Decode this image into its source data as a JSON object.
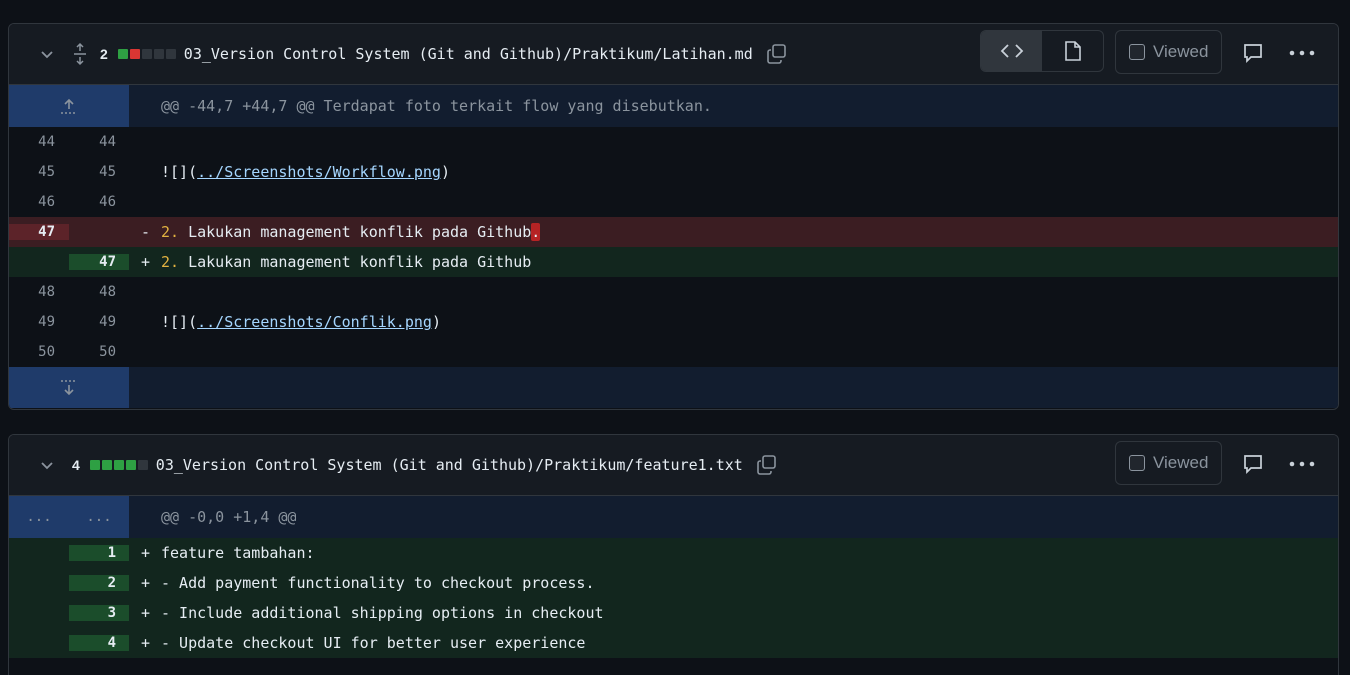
{
  "files": [
    {
      "change_count": "2",
      "blocks": [
        "g",
        "r",
        "n",
        "n",
        "n"
      ],
      "filename": "03_Version Control System (Git and Github)/Praktikum/Latihan.md",
      "viewed_label": "Viewed",
      "hunk": "@@ -44,7 +44,7 @@ Terdapat foto terkait flow yang disebutkan.",
      "lines": [
        {
          "type": "ctx",
          "old": "44",
          "new": "44",
          "sign": "",
          "text": ""
        },
        {
          "type": "ctx",
          "old": "45",
          "new": "45",
          "sign": "",
          "pre": "![](",
          "link": "../Screenshots/Workflow.png",
          "post": ")"
        },
        {
          "type": "ctx",
          "old": "46",
          "new": "46",
          "sign": "",
          "text": ""
        },
        {
          "type": "del",
          "old": "47",
          "new": "",
          "sign": "-",
          "num": "2.",
          "text": " Lakukan management konflik pada Github",
          "hl": "."
        },
        {
          "type": "add",
          "old": "",
          "new": "47",
          "sign": "+",
          "num": "2.",
          "text": " Lakukan management konflik pada Github"
        },
        {
          "type": "ctx",
          "old": "48",
          "new": "48",
          "sign": "",
          "text": ""
        },
        {
          "type": "ctx",
          "old": "49",
          "new": "49",
          "sign": "",
          "pre": "![](",
          "link": "../Screenshots/Conflik.png",
          "post": ")"
        },
        {
          "type": "ctx",
          "old": "50",
          "new": "50",
          "sign": "",
          "text": ""
        }
      ]
    },
    {
      "change_count": "4",
      "blocks": [
        "g",
        "g",
        "g",
        "g",
        "n"
      ],
      "filename": "03_Version Control System (Git and Github)/Praktikum/feature1.txt",
      "viewed_label": "Viewed",
      "hunk_dots_left": "...",
      "hunk_dots_right": "...",
      "hunk": "@@ -0,0 +1,4 @@",
      "lines": [
        {
          "type": "add",
          "old": "",
          "new": "1",
          "sign": "+",
          "text": "feature tambahan:"
        },
        {
          "type": "add",
          "old": "",
          "new": "2",
          "sign": "+",
          "text": "- Add payment functionality to checkout process."
        },
        {
          "type": "add",
          "old": "",
          "new": "3",
          "sign": "+",
          "text": "- Include additional shipping options in checkout"
        },
        {
          "type": "add",
          "old": "",
          "new": "4",
          "sign": "+",
          "text": "- Update checkout UI for better user experience"
        }
      ]
    }
  ]
}
